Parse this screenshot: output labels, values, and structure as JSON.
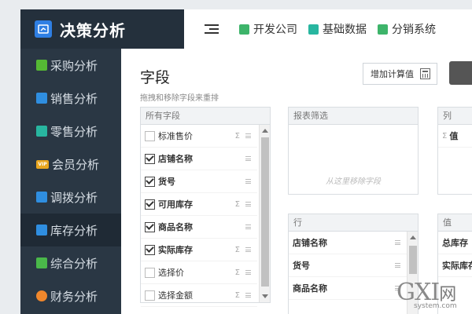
{
  "app": {
    "title": "决策分析"
  },
  "sidebar": {
    "items": [
      {
        "label": "采购分析",
        "icon": "purchase-icon",
        "color": "#55b934"
      },
      {
        "label": "销售分析",
        "icon": "sales-icon",
        "color": "#2f8ee0"
      },
      {
        "label": "零售分析",
        "icon": "retail-icon",
        "color": "#28b6a0"
      },
      {
        "label": "会员分析",
        "icon": "vip-icon",
        "color": "#e8a620",
        "badge": "VIP"
      },
      {
        "label": "调拨分析",
        "icon": "transfer-icon",
        "color": "#2f8ee0"
      },
      {
        "label": "库存分析",
        "icon": "inventory-icon",
        "color": "#2f8ee0",
        "active": true
      },
      {
        "label": "综合分析",
        "icon": "overview-icon",
        "color": "#4ab84a"
      },
      {
        "label": "财务分析",
        "icon": "finance-icon",
        "color": "#f0872c"
      }
    ]
  },
  "topbar": {
    "tabs": [
      {
        "label": "开发公司",
        "icon": "company-icon",
        "color": "#3db46a"
      },
      {
        "label": "基础数据",
        "icon": "basic-data-icon",
        "color": "#28b6a0"
      },
      {
        "label": "分销系统",
        "icon": "distribution-icon",
        "color": "#3db46a"
      }
    ]
  },
  "main": {
    "title": "字段",
    "subtitle": "拖拽和移除字段来重排",
    "calc_button": "增加计算值",
    "all_fields": {
      "header": "所有字段",
      "items": [
        {
          "label": "标准售价",
          "checked": false,
          "sigma": "Σ"
        },
        {
          "label": "店铺名称",
          "checked": true,
          "sigma": ""
        },
        {
          "label": "货号",
          "checked": true,
          "sigma": ""
        },
        {
          "label": "可用库存",
          "checked": true,
          "sigma": "Σ"
        },
        {
          "label": "商品名称",
          "checked": true,
          "sigma": ""
        },
        {
          "label": "实际库存",
          "checked": true,
          "sigma": "Σ"
        },
        {
          "label": "选择价",
          "checked": false,
          "sigma": "Σ"
        },
        {
          "label": "选择金额",
          "checked": false,
          "sigma": "Σ"
        }
      ]
    },
    "filter": {
      "header": "报表筛选",
      "hint": "从这里移除字段"
    },
    "columns": {
      "header": "列",
      "items": [
        {
          "label": "值",
          "sigma": "Σ"
        }
      ]
    },
    "rows": {
      "header": "行",
      "items": [
        {
          "label": "店铺名称"
        },
        {
          "label": "货号"
        },
        {
          "label": "商品名称"
        }
      ]
    },
    "values": {
      "header": "值",
      "items": [
        {
          "label": "总库存"
        },
        {
          "label": "实际库存"
        }
      ]
    }
  },
  "watermark": {
    "main": "GXI",
    "cn": "网",
    "sub": "system.com"
  }
}
